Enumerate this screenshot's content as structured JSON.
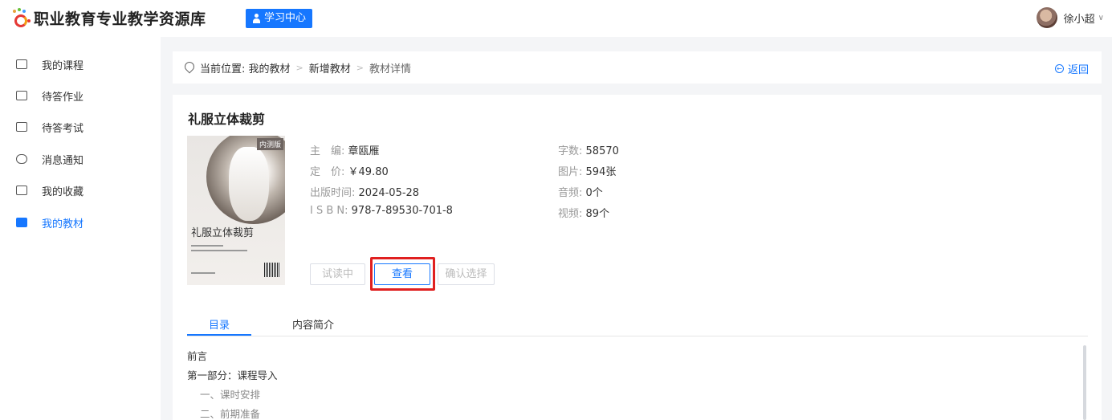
{
  "header": {
    "site_title": "职业教育专业教学资源库",
    "learn_center": "学习中心",
    "user_name": "徐小超"
  },
  "sidebar": {
    "items": [
      {
        "label": "我的课程"
      },
      {
        "label": "待答作业"
      },
      {
        "label": "待答考试"
      },
      {
        "label": "消息通知"
      },
      {
        "label": "我的收藏"
      },
      {
        "label": "我的教材"
      }
    ],
    "active_index": 5
  },
  "breadcrumb": {
    "location_prefix": "当前位置: 我的教材",
    "step2": "新增教材",
    "current": "教材详情",
    "back_label": "返回"
  },
  "book": {
    "title": "礼服立体裁剪",
    "cover_tag": "内测版",
    "cover_title": "礼服立体裁剪",
    "editor_label": "主　编:",
    "editor": "章瓯雁",
    "price_label": "定　价:",
    "price": "￥49.80",
    "pubdate_label": "出版时间:",
    "pubdate": "2024-05-28",
    "isbn_label": "I S B N:",
    "isbn": "978-7-89530-701-8",
    "words_label": "字数:",
    "words": "58570",
    "images_label": "图片:",
    "images": "594张",
    "audio_label": "音频:",
    "audio": "0个",
    "video_label": "视频:",
    "video": "89个"
  },
  "actions": {
    "trial": "试读中",
    "view": "查看",
    "confirm": "确认选择"
  },
  "tabs": [
    {
      "label": "目录"
    },
    {
      "label": "内容简介"
    }
  ],
  "toc": [
    {
      "label": "前言"
    },
    {
      "label": "第一部分：课程导入"
    },
    {
      "label": "一、课时安排"
    },
    {
      "label": "二、前期准备"
    }
  ],
  "colors": {
    "accent": "#1677ff",
    "highlight": "#e02020"
  }
}
